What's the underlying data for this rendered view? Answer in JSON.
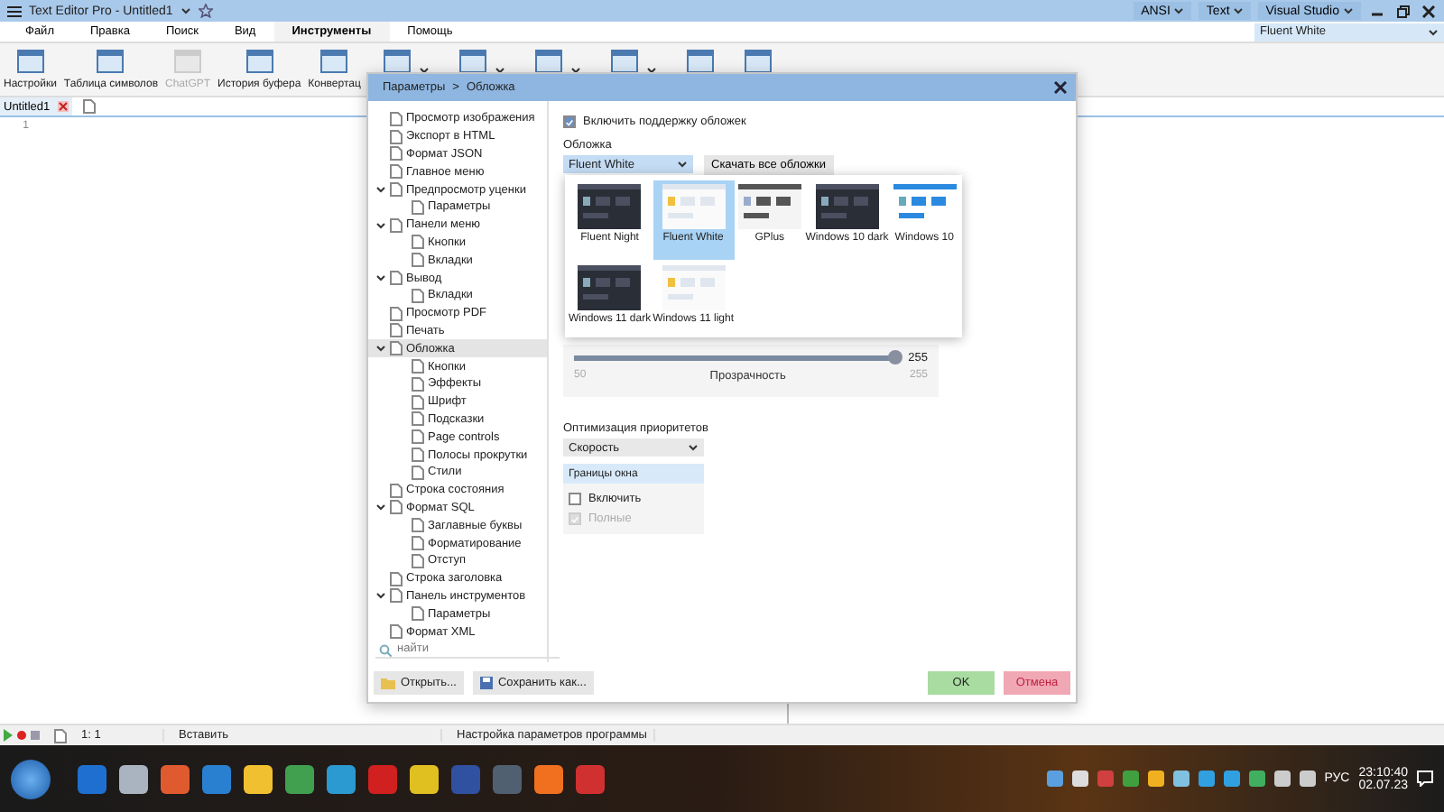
{
  "title_bar": {
    "title": "Text Editor Pro - Untitled1",
    "menus": [
      {
        "label": "ANSI"
      },
      {
        "label": "Text"
      },
      {
        "label": "Visual Studio"
      }
    ]
  },
  "ribbon_tabs": [
    {
      "label": "Файл",
      "selected": false
    },
    {
      "label": "Правка",
      "selected": false
    },
    {
      "label": "Поиск",
      "selected": false
    },
    {
      "label": "Вид",
      "selected": false
    },
    {
      "label": "Инструменты",
      "selected": true
    },
    {
      "label": "Помощь",
      "selected": false
    }
  ],
  "skin_select": {
    "value": "Fluent White"
  },
  "ribbon_buttons": [
    {
      "label": "Настройки",
      "disabled": false
    },
    {
      "label": "Таблица символов",
      "disabled": false
    },
    {
      "label": "ChatGPT",
      "disabled": true
    },
    {
      "label": "История буфера",
      "disabled": false
    },
    {
      "label": "Конвертац",
      "disabled": false
    }
  ],
  "doc_tabs": [
    {
      "label": "Untitled1",
      "selected": true
    }
  ],
  "editor": {
    "line_numbers": [
      "1"
    ]
  },
  "dialog": {
    "breadcrumb": [
      "Параметры",
      "Обложка"
    ],
    "separator": ">",
    "tree": [
      {
        "label": "Просмотр изображения",
        "selected": false
      },
      {
        "label": "Экспорт в HTML",
        "selected": false
      },
      {
        "label": "Формат JSON",
        "selected": false
      },
      {
        "label": "Главное меню",
        "selected": false
      },
      {
        "label": "Предпросмотр уценки",
        "selected": false,
        "expanded": true,
        "children": [
          {
            "label": "Параметры",
            "selected": false
          }
        ]
      },
      {
        "label": "Панели меню",
        "selected": false,
        "expanded": true,
        "children": [
          {
            "label": "Кнопки",
            "selected": false
          },
          {
            "label": "Вкладки",
            "selected": false
          }
        ]
      },
      {
        "label": "Вывод",
        "selected": false,
        "expanded": true,
        "children": [
          {
            "label": "Вкладки",
            "selected": false
          }
        ]
      },
      {
        "label": "Просмотр PDF",
        "selected": false
      },
      {
        "label": "Печать",
        "selected": false
      },
      {
        "label": "Обложка",
        "selected": true,
        "expanded": true,
        "children": [
          {
            "label": "Кнопки",
            "selected": false
          },
          {
            "label": "Эффекты",
            "selected": false
          },
          {
            "label": "Шрифт",
            "selected": false
          },
          {
            "label": "Подсказки",
            "selected": false
          },
          {
            "label": "Page controls",
            "selected": false
          },
          {
            "label": "Полосы прокрутки",
            "selected": false
          },
          {
            "label": "Стили",
            "selected": false
          }
        ]
      },
      {
        "label": "Строка состояния",
        "selected": false
      },
      {
        "label": "Формат SQL",
        "selected": false,
        "expanded": true,
        "children": [
          {
            "label": "Заглавные буквы",
            "selected": false
          },
          {
            "label": "Форматирование",
            "selected": false
          },
          {
            "label": "Отступ",
            "selected": false
          }
        ]
      },
      {
        "label": "Строка заголовка",
        "selected": false
      },
      {
        "label": "Панель инструментов",
        "selected": false,
        "expanded": true,
        "children": [
          {
            "label": "Параметры",
            "selected": false
          }
        ]
      },
      {
        "label": "Формат XML",
        "selected": false
      }
    ],
    "search": {
      "placeholder": "найти"
    },
    "enable_skins": {
      "label": "Включить поддержку обложек",
      "checked": true
    },
    "skin_label": "Обложка",
    "skin": {
      "value": "Fluent White"
    },
    "download_button": "Скачать все обложки",
    "skins": [
      {
        "label": "Fluent Night",
        "kind": "dark",
        "selected": false
      },
      {
        "label": "Fluent White",
        "kind": "light",
        "selected": true
      },
      {
        "label": "GPlus",
        "kind": "grey",
        "selected": false
      },
      {
        "label": "Windows 10 dark",
        "kind": "dark",
        "selected": false
      },
      {
        "label": "Windows 10",
        "kind": "blue",
        "selected": false
      },
      {
        "label": "Windows 11 dark",
        "kind": "dark",
        "selected": false
      },
      {
        "label": "Windows 11 light",
        "kind": "light",
        "selected": false
      }
    ],
    "opacity": {
      "level": 1,
      "reading": "255",
      "min": "50",
      "label": "Прозрачность",
      "max": "255"
    },
    "priority_label": "Оптимизация приоритетов",
    "priority": {
      "value": "Скорость"
    },
    "borders": {
      "title": "Границы окна",
      "options": [
        {
          "label": "Включить",
          "checked": false,
          "disabled": false
        },
        {
          "label": "Полные",
          "checked": true,
          "disabled": true
        }
      ]
    },
    "buttons": [
      {
        "label": "Открыть...",
        "kind": "open"
      },
      {
        "label": "Сохранить как...",
        "kind": "save"
      },
      {
        "label": "OK",
        "kind": "ok"
      },
      {
        "label": "Отмена",
        "kind": "cancel"
      }
    ]
  },
  "status_bar": {
    "position": "1: 1",
    "mode": "Вставить",
    "message": "Настройка параметров программы"
  },
  "taskbar": {
    "language": "РУС",
    "time": "23:10:40",
    "date": "02.07.23"
  }
}
